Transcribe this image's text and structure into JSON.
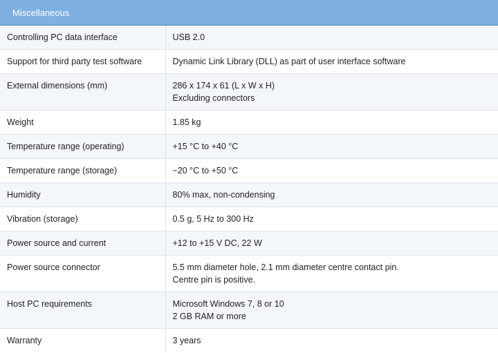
{
  "header": {
    "title": "Miscellaneous"
  },
  "rows": [
    {
      "label": "Controlling PC data interface",
      "lines": [
        "USB 2.0"
      ]
    },
    {
      "label": "Support for third party test software",
      "lines": [
        "Dynamic Link Library (DLL) as part of user interface software"
      ]
    },
    {
      "label": "External dimensions (mm)",
      "lines": [
        "286 x 174 x 61 (L x W x H)",
        "Excluding connectors"
      ]
    },
    {
      "label": "Weight",
      "lines": [
        "1.85 kg"
      ]
    },
    {
      "label": "Temperature range (operating)",
      "lines": [
        "+15 °C to +40 °C"
      ]
    },
    {
      "label": "Temperature range (storage)",
      "lines": [
        "−20 °C to +50 °C"
      ]
    },
    {
      "label": "Humidity",
      "lines": [
        "80% max, non-condensing"
      ]
    },
    {
      "label": "Vibration (storage)",
      "lines": [
        "0.5 g, 5 Hz to 300 Hz"
      ]
    },
    {
      "label": "Power source and current",
      "lines": [
        "+12 to +15 V DC, 22 W"
      ]
    },
    {
      "label": "Power source connector",
      "lines": [
        "5.5 mm diameter hole, 2.1 mm diameter centre contact pin.",
        "Centre pin is positive."
      ]
    },
    {
      "label": "Host PC requirements",
      "lines": [
        "Microsoft Windows 7, 8 or 10",
        "2 GB RAM or more"
      ]
    },
    {
      "label": "Warranty",
      "lines": [
        "3 years"
      ]
    }
  ]
}
